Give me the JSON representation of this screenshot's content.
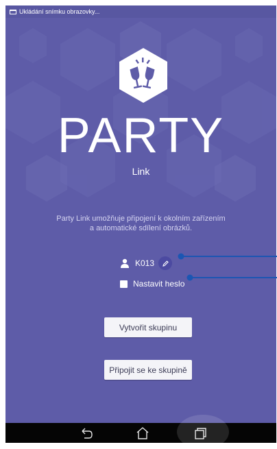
{
  "status_bar": {
    "notification_icon": "screenshot-icon",
    "text": "Ukládání snímku obrazovky..."
  },
  "app": {
    "logo_icon": "wine-glasses-toast-icon",
    "title": "PARTY",
    "subtitle": "Link",
    "description_line1": "Party Link umožňuje připojení k okolním zařízením",
    "description_line2": "a automatické sdílení obrázků."
  },
  "user": {
    "icon": "person-icon",
    "name": "K013",
    "edit_icon": "pencil-icon"
  },
  "password": {
    "checked": false,
    "label": "Nastavit heslo"
  },
  "buttons": {
    "create_group": "Vytvořit skupinu",
    "join_group": "Připojit se ke skupině"
  },
  "nav_bar": {
    "back_icon": "back-icon",
    "home_icon": "home-icon",
    "recent_icon": "recent-apps-icon"
  },
  "colors": {
    "background": "#5e5ca8",
    "accent_blue": "#1b56b3",
    "button_bg": "#f4f4f8"
  }
}
